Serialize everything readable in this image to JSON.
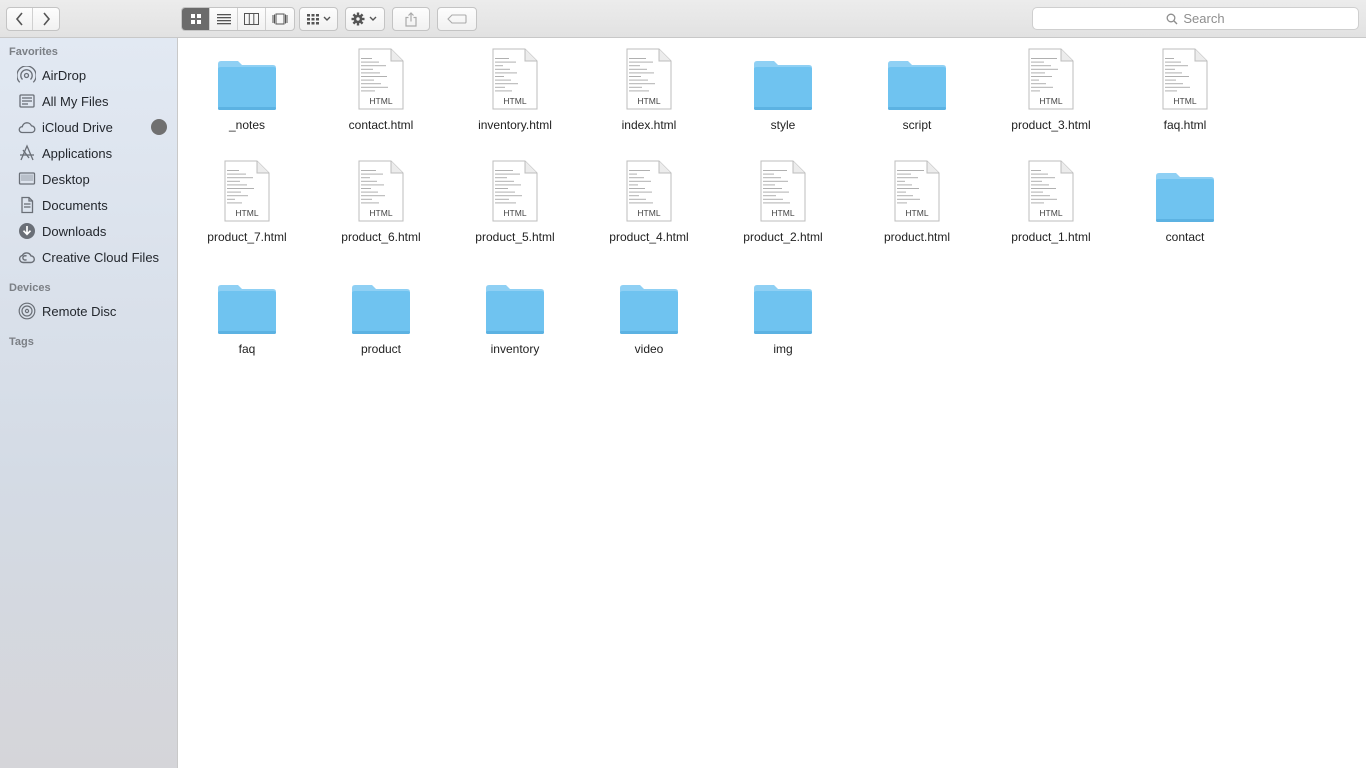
{
  "toolbar": {
    "back_icon": "chevron-left-icon",
    "forward_icon": "chevron-right-icon",
    "views": [
      "icon-view",
      "list-view",
      "column-view",
      "cover-flow-view"
    ],
    "active_view": "icon-view",
    "group_icon": "group-by-icon",
    "action_icon": "gear-icon",
    "share_icon": "share-icon",
    "tag_icon": "tag-icon",
    "search_placeholder": "Search"
  },
  "sidebar": {
    "favorites_header": "Favorites",
    "favorites": [
      {
        "label": "AirDrop",
        "icon": "airdrop-icon"
      },
      {
        "label": "All My Files",
        "icon": "all-files-icon"
      },
      {
        "label": "iCloud Drive",
        "icon": "cloud-icon"
      },
      {
        "label": "Applications",
        "icon": "applications-icon"
      },
      {
        "label": "Desktop",
        "icon": "desktop-icon"
      },
      {
        "label": "Documents",
        "icon": "documents-icon"
      },
      {
        "label": "Downloads",
        "icon": "downloads-icon"
      },
      {
        "label": "Creative Cloud Files",
        "icon": "creative-cloud-icon"
      }
    ],
    "devices_header": "Devices",
    "devices": [
      {
        "label": "Remote Disc",
        "icon": "disc-icon"
      }
    ],
    "tags_header": "Tags"
  },
  "files": [
    {
      "name": "_notes",
      "kind": "folder"
    },
    {
      "name": "contact.html",
      "kind": "html",
      "tag": "HTML"
    },
    {
      "name": "inventory.html",
      "kind": "html",
      "tag": "HTML"
    },
    {
      "name": "index.html",
      "kind": "html",
      "tag": "HTML"
    },
    {
      "name": "style",
      "kind": "folder"
    },
    {
      "name": "script",
      "kind": "folder"
    },
    {
      "name": "product_3.html",
      "kind": "html",
      "tag": "HTML"
    },
    {
      "name": "faq.html",
      "kind": "html",
      "tag": "HTML"
    },
    {
      "name": "product_7.html",
      "kind": "html",
      "tag": "HTML"
    },
    {
      "name": "product_6.html",
      "kind": "html",
      "tag": "HTML"
    },
    {
      "name": "product_5.html",
      "kind": "html",
      "tag": "HTML"
    },
    {
      "name": "product_4.html",
      "kind": "html",
      "tag": "HTML"
    },
    {
      "name": "product_2.html",
      "kind": "html",
      "tag": "HTML"
    },
    {
      "name": "product.html",
      "kind": "html",
      "tag": "HTML"
    },
    {
      "name": "product_1.html",
      "kind": "html",
      "tag": "HTML"
    },
    {
      "name": "contact",
      "kind": "folder"
    },
    {
      "name": "faq",
      "kind": "folder"
    },
    {
      "name": "product",
      "kind": "folder"
    },
    {
      "name": "inventory",
      "kind": "folder"
    },
    {
      "name": "video",
      "kind": "folder"
    },
    {
      "name": "img",
      "kind": "folder"
    }
  ],
  "colors": {
    "folder": "#6fc3f0",
    "folder_tab": "#8fd0f4",
    "icloud_badge": "#707070"
  }
}
